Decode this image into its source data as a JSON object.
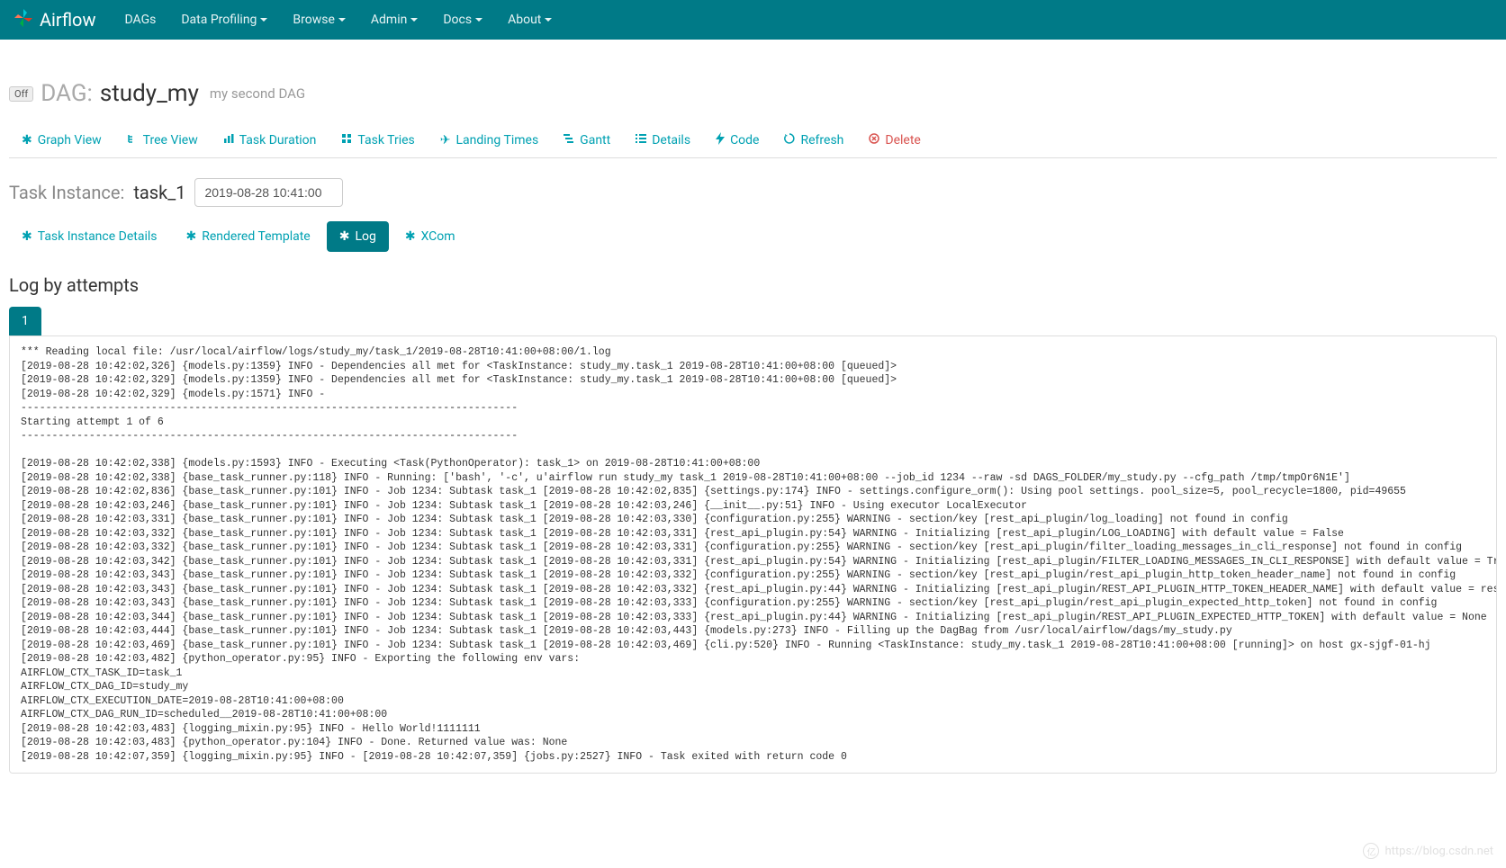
{
  "navbar": {
    "brand": "Airflow",
    "items": [
      {
        "label": "DAGs",
        "dropdown": false
      },
      {
        "label": "Data Profiling",
        "dropdown": true
      },
      {
        "label": "Browse",
        "dropdown": true
      },
      {
        "label": "Admin",
        "dropdown": true
      },
      {
        "label": "Docs",
        "dropdown": true
      },
      {
        "label": "About",
        "dropdown": true
      }
    ]
  },
  "dag": {
    "toggle": "Off",
    "prefix": "DAG:",
    "name": "study_my",
    "description": "my second DAG"
  },
  "view_tabs": [
    {
      "icon": "graph",
      "label": "Graph View"
    },
    {
      "icon": "tree",
      "label": "Tree View"
    },
    {
      "icon": "bar",
      "label": "Task Duration"
    },
    {
      "icon": "tries",
      "label": "Task Tries"
    },
    {
      "icon": "plane",
      "label": "Landing Times"
    },
    {
      "icon": "gantt",
      "label": "Gantt"
    },
    {
      "icon": "list",
      "label": "Details"
    },
    {
      "icon": "bolt",
      "label": "Code"
    },
    {
      "icon": "refresh",
      "label": "Refresh"
    },
    {
      "icon": "delete",
      "label": "Delete"
    }
  ],
  "task_instance": {
    "label": "Task Instance:",
    "task": "task_1",
    "execution_date": "2019-08-28 10:41:00"
  },
  "sub_tabs": [
    {
      "label": "Task Instance Details",
      "active": false
    },
    {
      "label": "Rendered Template",
      "active": false
    },
    {
      "label": "Log",
      "active": true
    },
    {
      "label": "XCom",
      "active": false
    }
  ],
  "log": {
    "section_title": "Log by attempts",
    "attempt": "1",
    "content": "*** Reading local file: /usr/local/airflow/logs/study_my/task_1/2019-08-28T10:41:00+08:00/1.log\n[2019-08-28 10:42:02,326] {models.py:1359} INFO - Dependencies all met for <TaskInstance: study_my.task_1 2019-08-28T10:41:00+08:00 [queued]>\n[2019-08-28 10:42:02,329] {models.py:1359} INFO - Dependencies all met for <TaskInstance: study_my.task_1 2019-08-28T10:41:00+08:00 [queued]>\n[2019-08-28 10:42:02,329] {models.py:1571} INFO - \n--------------------------------------------------------------------------------\nStarting attempt 1 of 6\n--------------------------------------------------------------------------------\n\n[2019-08-28 10:42:02,338] {models.py:1593} INFO - Executing <Task(PythonOperator): task_1> on 2019-08-28T10:41:00+08:00\n[2019-08-28 10:42:02,338] {base_task_runner.py:118} INFO - Running: ['bash', '-c', u'airflow run study_my task_1 2019-08-28T10:41:00+08:00 --job_id 1234 --raw -sd DAGS_FOLDER/my_study.py --cfg_path /tmp/tmpOr6N1E']\n[2019-08-28 10:42:02,836] {base_task_runner.py:101} INFO - Job 1234: Subtask task_1 [2019-08-28 10:42:02,835] {settings.py:174} INFO - settings.configure_orm(): Using pool settings. pool_size=5, pool_recycle=1800, pid=49655\n[2019-08-28 10:42:03,246] {base_task_runner.py:101} INFO - Job 1234: Subtask task_1 [2019-08-28 10:42:03,246] {__init__.py:51} INFO - Using executor LocalExecutor\n[2019-08-28 10:42:03,331] {base_task_runner.py:101} INFO - Job 1234: Subtask task_1 [2019-08-28 10:42:03,330] {configuration.py:255} WARNING - section/key [rest_api_plugin/log_loading] not found in config\n[2019-08-28 10:42:03,332] {base_task_runner.py:101} INFO - Job 1234: Subtask task_1 [2019-08-28 10:42:03,331] {rest_api_plugin.py:54} WARNING - Initializing [rest_api_plugin/LOG_LOADING] with default value = False\n[2019-08-28 10:42:03,332] {base_task_runner.py:101} INFO - Job 1234: Subtask task_1 [2019-08-28 10:42:03,331] {configuration.py:255} WARNING - section/key [rest_api_plugin/filter_loading_messages_in_cli_response] not found in config\n[2019-08-28 10:42:03,342] {base_task_runner.py:101} INFO - Job 1234: Subtask task_1 [2019-08-28 10:42:03,331] {rest_api_plugin.py:54} WARNING - Initializing [rest_api_plugin/FILTER_LOADING_MESSAGES_IN_CLI_RESPONSE] with default value = True\n[2019-08-28 10:42:03,343] {base_task_runner.py:101} INFO - Job 1234: Subtask task_1 [2019-08-28 10:42:03,332] {configuration.py:255} WARNING - section/key [rest_api_plugin/rest_api_plugin_http_token_header_name] not found in config\n[2019-08-28 10:42:03,343] {base_task_runner.py:101} INFO - Job 1234: Subtask task_1 [2019-08-28 10:42:03,332] {rest_api_plugin.py:44} WARNING - Initializing [rest_api_plugin/REST_API_PLUGIN_HTTP_TOKEN_HEADER_NAME] with default value = rest_api_plugin_http_token\n[2019-08-28 10:42:03,343] {base_task_runner.py:101} INFO - Job 1234: Subtask task_1 [2019-08-28 10:42:03,333] {configuration.py:255} WARNING - section/key [rest_api_plugin/rest_api_plugin_expected_http_token] not found in config\n[2019-08-28 10:42:03,344] {base_task_runner.py:101} INFO - Job 1234: Subtask task_1 [2019-08-28 10:42:03,333] {rest_api_plugin.py:44} WARNING - Initializing [rest_api_plugin/REST_API_PLUGIN_EXPECTED_HTTP_TOKEN] with default value = None\n[2019-08-28 10:42:03,444] {base_task_runner.py:101} INFO - Job 1234: Subtask task_1 [2019-08-28 10:42:03,443] {models.py:273} INFO - Filling up the DagBag from /usr/local/airflow/dags/my_study.py\n[2019-08-28 10:42:03,469] {base_task_runner.py:101} INFO - Job 1234: Subtask task_1 [2019-08-28 10:42:03,469] {cli.py:520} INFO - Running <TaskInstance: study_my.task_1 2019-08-28T10:41:00+08:00 [running]> on host gx-sjgf-01-hj\n[2019-08-28 10:42:03,482] {python_operator.py:95} INFO - Exporting the following env vars:\nAIRFLOW_CTX_TASK_ID=task_1\nAIRFLOW_CTX_DAG_ID=study_my\nAIRFLOW_CTX_EXECUTION_DATE=2019-08-28T10:41:00+08:00\nAIRFLOW_CTX_DAG_RUN_ID=scheduled__2019-08-28T10:41:00+08:00\n[2019-08-28 10:42:03,483] {logging_mixin.py:95} INFO - Hello World!1111111\n[2019-08-28 10:42:03,483] {python_operator.py:104} INFO - Done. Returned value was: None\n[2019-08-28 10:42:07,359] {logging_mixin.py:95} INFO - [2019-08-28 10:42:07,359] {jobs.py:2527} INFO - Task exited with return code 0"
  },
  "watermark": "https://blog.csdn.net"
}
